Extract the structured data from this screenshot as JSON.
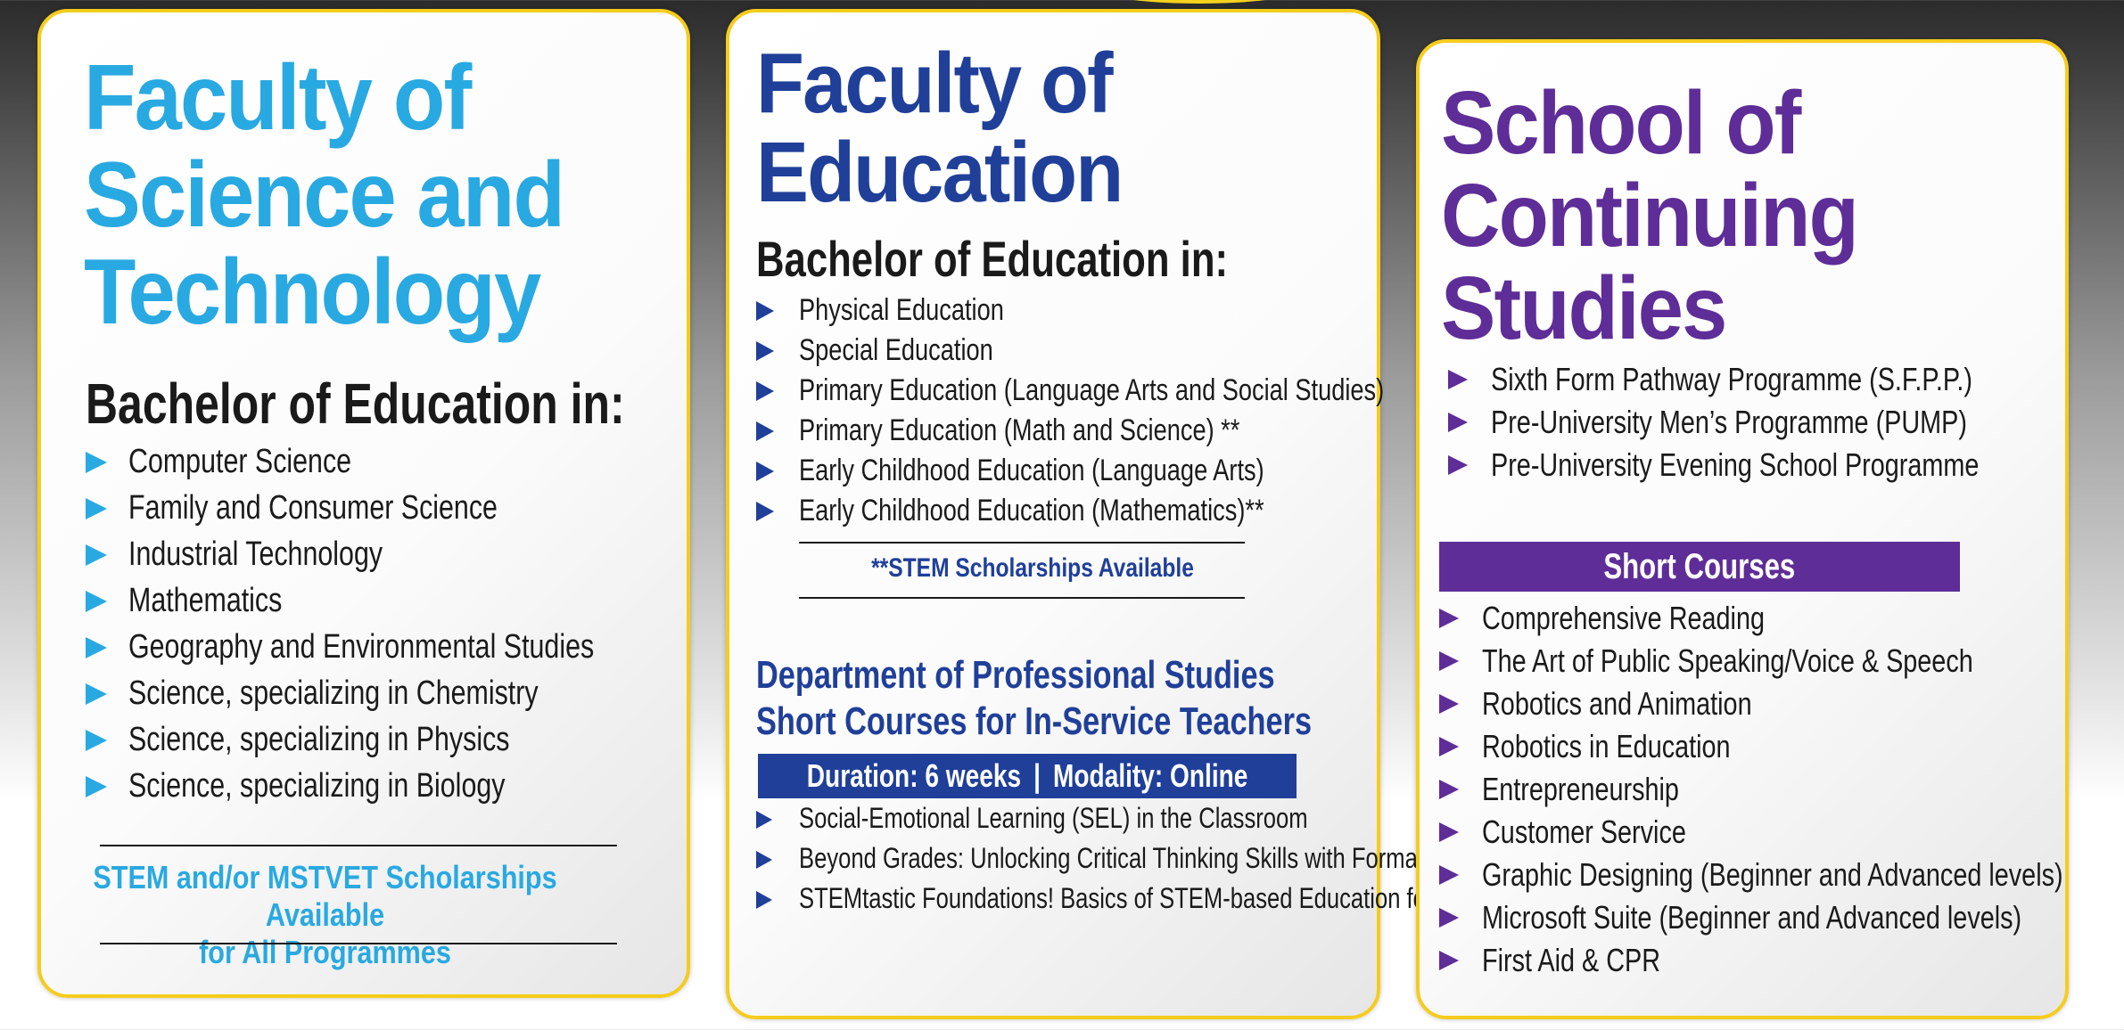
{
  "colors": {
    "science_blue": "#29a9e1",
    "education_navy": "#1f3f99",
    "continuing_purple": "#5e2d97",
    "card_border_yellow": "#f5cc1c"
  },
  "science": {
    "title_lines": [
      "Faculty of",
      "Science and",
      "Technology"
    ],
    "subtitle": "Bachelor of Education in:",
    "programmes": [
      "Computer Science",
      "Family and Consumer Science",
      "Industrial Technology",
      "Mathematics",
      "Geography and Environmental Studies",
      "Science, specializing in Chemistry",
      "Science, specializing in Physics",
      "Science, specializing in Biology"
    ],
    "scholarship_lines": [
      "STEM and/or MSTVET Scholarships Available",
      "for All Programmes"
    ]
  },
  "education": {
    "title_lines": [
      "Faculty of",
      "Education"
    ],
    "subtitle": "Bachelor of Education in:",
    "programmes": [
      "Physical Education",
      "Special Education",
      "Primary Education (Language Arts and Social Studies)",
      "Primary Education (Math and Science) **",
      "Early Childhood Education (Language Arts)",
      "Early Childhood Education (Mathematics)**"
    ],
    "scholarship_note": "**STEM Scholarships Available",
    "dept_lines": [
      "Department of Professional Studies",
      "Short Courses for In-Service Teachers"
    ],
    "duration": "Duration: 6 weeks",
    "separator": "|",
    "modality": "Modality: Online",
    "short_courses": [
      "Social-Emotional Learning (SEL) in the Classroom",
      "Beyond Grades: Unlocking Critical Thinking Skills with Formative Assessments",
      "STEMtastic Foundations! Basics of STEM-based Education for Early Educators"
    ]
  },
  "continuing": {
    "title_lines": [
      "School of",
      "Continuing",
      "Studies"
    ],
    "programmes": [
      "Sixth Form Pathway Programme (S.F.P.P.)",
      "Pre-University Men’s Programme (PUMP)",
      "Pre-University Evening School Programme"
    ],
    "short_courses_heading": "Short Courses",
    "short_courses": [
      "Comprehensive Reading",
      "The Art of Public Speaking/Voice & Speech",
      "Robotics and Animation",
      "Robotics in Education",
      "Entrepreneurship",
      "Customer Service",
      "Graphic Designing (Beginner and Advanced levels)",
      "Microsoft Suite (Beginner and Advanced levels)",
      "First Aid & CPR"
    ]
  }
}
